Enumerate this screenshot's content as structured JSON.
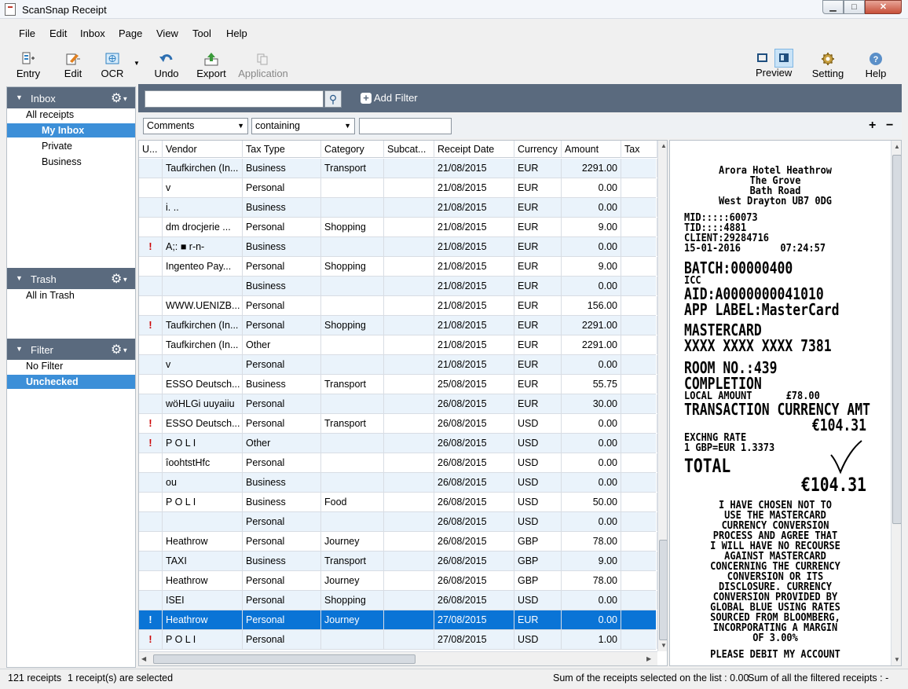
{
  "window": {
    "title": "ScanSnap Receipt"
  },
  "menu": [
    "File",
    "Edit",
    "Inbox",
    "Page",
    "View",
    "Tool",
    "Help"
  ],
  "toolbar": {
    "entry": "Entry",
    "edit": "Edit",
    "ocr": "OCR",
    "undo": "Undo",
    "export": "Export",
    "application": "Application",
    "preview": "Preview",
    "setting": "Setting",
    "help": "Help"
  },
  "sidebar": {
    "inbox": {
      "title": "Inbox",
      "all": "All receipts",
      "my": "My Inbox",
      "private": "Private",
      "business": "Business"
    },
    "trash": {
      "title": "Trash",
      "all": "All in Trash"
    },
    "filter": {
      "title": "Filter",
      "none": "No Filter",
      "unchecked": "Unchecked"
    }
  },
  "filterbar": {
    "search_value": "",
    "add_filter": "Add Filter",
    "field": "Comments",
    "operator": "containing",
    "value": ""
  },
  "table": {
    "columns": [
      "U...",
      "Vendor",
      "Tax Type",
      "Category",
      "Subcat...",
      "Receipt Date",
      "Currency",
      "Amount",
      "Tax"
    ],
    "rows": [
      {
        "flag": "",
        "vendor": "Taufkirchen (In...",
        "tax_type": "Business",
        "category": "Transport",
        "subcat": "",
        "date": "21/08/2015",
        "currency": "EUR",
        "amount": "2291.00",
        "tax": ""
      },
      {
        "flag": "",
        "vendor": "v",
        "tax_type": "Personal",
        "category": "",
        "subcat": "",
        "date": "21/08/2015",
        "currency": "EUR",
        "amount": "0.00",
        "tax": ""
      },
      {
        "flag": "",
        "vendor": "i. ..",
        "tax_type": "Business",
        "category": "",
        "subcat": "",
        "date": "21/08/2015",
        "currency": "EUR",
        "amount": "0.00",
        "tax": ""
      },
      {
        "flag": "",
        "vendor": "dm drocjerie ...",
        "tax_type": "Personal",
        "category": "Shopping",
        "subcat": "",
        "date": "21/08/2015",
        "currency": "EUR",
        "amount": "9.00",
        "tax": ""
      },
      {
        "flag": "!",
        "vendor": "A;: ■ r-n-",
        "tax_type": "Business",
        "category": "",
        "subcat": "",
        "date": "21/08/2015",
        "currency": "EUR",
        "amount": "0.00",
        "tax": ""
      },
      {
        "flag": "",
        "vendor": "Ingenteo Pay...",
        "tax_type": "Personal",
        "category": "Shopping",
        "subcat": "",
        "date": "21/08/2015",
        "currency": "EUR",
        "amount": "9.00",
        "tax": ""
      },
      {
        "flag": "",
        "vendor": "",
        "tax_type": "Business",
        "category": "",
        "subcat": "",
        "date": "21/08/2015",
        "currency": "EUR",
        "amount": "0.00",
        "tax": ""
      },
      {
        "flag": "",
        "vendor": "WWW.UENIZB...",
        "tax_type": "Personal",
        "category": "",
        "subcat": "",
        "date": "21/08/2015",
        "currency": "EUR",
        "amount": "156.00",
        "tax": ""
      },
      {
        "flag": "!",
        "vendor": "Taufkirchen (In...",
        "tax_type": "Personal",
        "category": "Shopping",
        "subcat": "",
        "date": "21/08/2015",
        "currency": "EUR",
        "amount": "2291.00",
        "tax": ""
      },
      {
        "flag": "",
        "vendor": "Taufkirchen (In...",
        "tax_type": "Other",
        "category": "",
        "subcat": "",
        "date": "21/08/2015",
        "currency": "EUR",
        "amount": "2291.00",
        "tax": ""
      },
      {
        "flag": "",
        "vendor": "v",
        "tax_type": "Personal",
        "category": "",
        "subcat": "",
        "date": "21/08/2015",
        "currency": "EUR",
        "amount": "0.00",
        "tax": ""
      },
      {
        "flag": "",
        "vendor": "ESSO Deutsch...",
        "tax_type": "Business",
        "category": "Transport",
        "subcat": "",
        "date": "25/08/2015",
        "currency": "EUR",
        "amount": "55.75",
        "tax": ""
      },
      {
        "flag": "",
        "vendor": "wöHLGi uuyaiiu",
        "tax_type": "Personal",
        "category": "",
        "subcat": "",
        "date": "26/08/2015",
        "currency": "EUR",
        "amount": "30.00",
        "tax": ""
      },
      {
        "flag": "!",
        "vendor": "ESSO Deutsch...",
        "tax_type": "Personal",
        "category": "Transport",
        "subcat": "",
        "date": "26/08/2015",
        "currency": "USD",
        "amount": "0.00",
        "tax": ""
      },
      {
        "flag": "!",
        "vendor": "P O L I",
        "tax_type": "Other",
        "category": "",
        "subcat": "",
        "date": "26/08/2015",
        "currency": "USD",
        "amount": "0.00",
        "tax": ""
      },
      {
        "flag": "",
        "vendor": "îoohtstHfc",
        "tax_type": "Personal",
        "category": "",
        "subcat": "",
        "date": "26/08/2015",
        "currency": "USD",
        "amount": "0.00",
        "tax": ""
      },
      {
        "flag": "",
        "vendor": "ou",
        "tax_type": "Business",
        "category": "",
        "subcat": "",
        "date": "26/08/2015",
        "currency": "USD",
        "amount": "0.00",
        "tax": ""
      },
      {
        "flag": "",
        "vendor": "P O L I",
        "tax_type": "Business",
        "category": "Food",
        "subcat": "",
        "date": "26/08/2015",
        "currency": "USD",
        "amount": "50.00",
        "tax": ""
      },
      {
        "flag": "",
        "vendor": "",
        "tax_type": "Personal",
        "category": "",
        "subcat": "",
        "date": "26/08/2015",
        "currency": "USD",
        "amount": "0.00",
        "tax": ""
      },
      {
        "flag": "",
        "vendor": "Heathrow",
        "tax_type": "Personal",
        "category": "Journey",
        "subcat": "",
        "date": "26/08/2015",
        "currency": "GBP",
        "amount": "78.00",
        "tax": ""
      },
      {
        "flag": "",
        "vendor": "TAXI",
        "tax_type": "Business",
        "category": "Transport",
        "subcat": "",
        "date": "26/08/2015",
        "currency": "GBP",
        "amount": "9.00",
        "tax": ""
      },
      {
        "flag": "",
        "vendor": "Heathrow",
        "tax_type": "Personal",
        "category": "Journey",
        "subcat": "",
        "date": "26/08/2015",
        "currency": "GBP",
        "amount": "78.00",
        "tax": ""
      },
      {
        "flag": "",
        "vendor": "ISEI",
        "tax_type": "Personal",
        "category": "Shopping",
        "subcat": "",
        "date": "26/08/2015",
        "currency": "USD",
        "amount": "0.00",
        "tax": ""
      },
      {
        "flag": "!",
        "vendor": "Heathrow",
        "tax_type": "Personal",
        "category": "Journey",
        "subcat": "",
        "date": "27/08/2015",
        "currency": "EUR",
        "amount": "0.00",
        "tax": "",
        "selected": true
      },
      {
        "flag": "!",
        "vendor": "P O L I",
        "tax_type": "Personal",
        "category": "",
        "subcat": "",
        "date": "27/08/2015",
        "currency": "USD",
        "amount": "1.00",
        "tax": ""
      }
    ]
  },
  "receipt": {
    "lines": [
      {
        "t": "Arora Hotel Heathrow",
        "s": 13,
        "w": "bold",
        "a": "center"
      },
      {
        "t": "The Grove",
        "s": 13,
        "w": "bold",
        "a": "center"
      },
      {
        "t": "Bath Road",
        "s": 13,
        "w": "bold",
        "a": "center"
      },
      {
        "t": "West Drayton UB7 0DG",
        "s": 13,
        "w": "bold",
        "a": "center"
      },
      {
        "t": "",
        "s": 8,
        "w": "normal",
        "a": "left"
      },
      {
        "t": "MID:::::60073",
        "s": 13,
        "w": "bold",
        "a": "left"
      },
      {
        "t": "TID::::4881",
        "s": 13,
        "w": "bold",
        "a": "left"
      },
      {
        "t": "CLIENT:29284716",
        "s": 13,
        "w": "bold",
        "a": "left"
      },
      {
        "t": "15-01-2016       07:24:57",
        "s": 13,
        "w": "bold",
        "a": "left"
      },
      {
        "t": "",
        "s": 8,
        "w": "normal",
        "a": "left"
      },
      {
        "t": "BATCH:00000400",
        "s": 20,
        "w": "bold",
        "a": "left"
      },
      {
        "t": "ICC",
        "s": 13,
        "w": "bold",
        "a": "left"
      },
      {
        "t": "AID:A0000000041010",
        "s": 20,
        "w": "bold",
        "a": "left"
      },
      {
        "t": "APP LABEL:MasterCard",
        "s": 20,
        "w": "bold",
        "a": "left"
      },
      {
        "t": "",
        "s": 6,
        "w": "normal",
        "a": "left"
      },
      {
        "t": "MASTERCARD",
        "s": 20,
        "w": "bold",
        "a": "left"
      },
      {
        "t": "XXXX XXXX XXXX 7381",
        "s": 20,
        "w": "bold",
        "a": "left"
      },
      {
        "t": "",
        "s": 8,
        "w": "normal",
        "a": "left"
      },
      {
        "t": "ROOM NO.:439",
        "s": 20,
        "w": "bold",
        "a": "left"
      },
      {
        "t": "COMPLETION",
        "s": 20,
        "w": "bold",
        "a": "left"
      },
      {
        "t": "LOCAL AMOUNT      £78.00",
        "s": 13,
        "w": "bold",
        "a": "left"
      },
      {
        "t": "TRANSACTION CURRENCY AMT",
        "s": 20,
        "w": "bold",
        "a": "left"
      },
      {
        "t": "€104.31",
        "s": 20,
        "w": "bold",
        "a": "right"
      },
      {
        "t": "EXCHNG RATE",
        "s": 13,
        "w": "bold",
        "a": "left"
      },
      {
        "t": "1 GBP=EUR 1.3373",
        "s": 13,
        "w": "bold",
        "a": "left"
      },
      {
        "t": "",
        "s": 4,
        "w": "normal",
        "a": "left"
      },
      {
        "t": "TOTAL",
        "s": 24,
        "w": "bold",
        "a": "left"
      },
      {
        "t": "€104.31",
        "s": 24,
        "w": "bold",
        "a": "right"
      },
      {
        "t": "",
        "s": 8,
        "w": "normal",
        "a": "left"
      },
      {
        "t": "I HAVE CHOSEN NOT TO",
        "s": 13,
        "w": "bold",
        "a": "center"
      },
      {
        "t": "USE THE MASTERCARD",
        "s": 13,
        "w": "bold",
        "a": "center"
      },
      {
        "t": "CURRENCY CONVERSION",
        "s": 13,
        "w": "bold",
        "a": "center"
      },
      {
        "t": "PROCESS AND AGREE THAT",
        "s": 13,
        "w": "bold",
        "a": "center"
      },
      {
        "t": "I WILL HAVE NO RECOURSE",
        "s": 13,
        "w": "bold",
        "a": "center"
      },
      {
        "t": "AGAINST MASTERCARD",
        "s": 13,
        "w": "bold",
        "a": "center"
      },
      {
        "t": "CONCERNING THE CURRENCY",
        "s": 13,
        "w": "bold",
        "a": "center"
      },
      {
        "t": "CONVERSION OR ITS",
        "s": 13,
        "w": "bold",
        "a": "center"
      },
      {
        "t": "DISCLOSURE. CURRENCY",
        "s": 13,
        "w": "bold",
        "a": "center"
      },
      {
        "t": "CONVERSION PROVIDED BY",
        "s": 13,
        "w": "bold",
        "a": "center"
      },
      {
        "t": "GLOBAL BLUE USING RATES",
        "s": 13,
        "w": "bold",
        "a": "center"
      },
      {
        "t": "SOURCED FROM BLOOMBERG,",
        "s": 13,
        "w": "bold",
        "a": "center"
      },
      {
        "t": "INCORPORATING A MARGIN",
        "s": 13,
        "w": "bold",
        "a": "center"
      },
      {
        "t": "OF 3.00%",
        "s": 13,
        "w": "bold",
        "a": "center"
      },
      {
        "t": "",
        "s": 8,
        "w": "normal",
        "a": "left"
      },
      {
        "t": "PLEASE DEBIT MY ACCOUNT",
        "s": 13,
        "w": "bold",
        "a": "center"
      }
    ]
  },
  "status": {
    "count": "121 receipts",
    "selected": "1 receipt(s) are selected",
    "sum_selected": "Sum of the receipts selected on the list : 0.00",
    "sum_filtered": "Sum of all the filtered receipts : -"
  }
}
